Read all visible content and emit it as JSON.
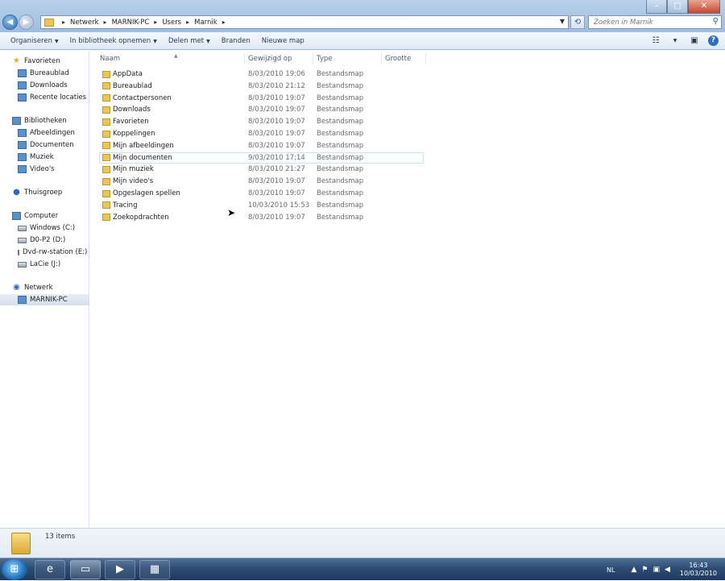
{
  "address": {
    "crumbs": [
      "Netwerk",
      "MARNIK-PC",
      "Users",
      "Marnik"
    ],
    "search_placeholder": "Zoeken in Marnik"
  },
  "toolbar": {
    "organize": "Organiseren",
    "library": "In bibliotheek opnemen",
    "share": "Delen met",
    "burn": "Branden",
    "new_folder": "Nieuwe map"
  },
  "nav": {
    "favorites": {
      "label": "Favorieten",
      "items": [
        "Bureaublad",
        "Downloads",
        "Recente locaties"
      ]
    },
    "libraries": {
      "label": "Bibliotheken",
      "items": [
        "Afbeeldingen",
        "Documenten",
        "Muziek",
        "Video's"
      ]
    },
    "homegroup": "Thuisgroep",
    "computer": {
      "label": "Computer",
      "items": [
        "Windows (C:)",
        "D0-P2 (D:)",
        "Dvd-rw-station (E:) (",
        "LaCie (J:)"
      ]
    },
    "network": {
      "label": "Netwerk",
      "items": [
        "MARNIK-PC"
      ]
    }
  },
  "columns": {
    "name": "Naam",
    "modified": "Gewijzigd op",
    "type": "Type",
    "size": "Grootte"
  },
  "files": [
    {
      "name": "AppData",
      "date": "8/03/2010 19:06",
      "type": "Bestandsmap"
    },
    {
      "name": "Bureaublad",
      "date": "8/03/2010 21:12",
      "type": "Bestandsmap"
    },
    {
      "name": "Contactpersonen",
      "date": "8/03/2010 19:07",
      "type": "Bestandsmap"
    },
    {
      "name": "Downloads",
      "date": "8/03/2010 19:07",
      "type": "Bestandsmap"
    },
    {
      "name": "Favorieten",
      "date": "8/03/2010 19:07",
      "type": "Bestandsmap"
    },
    {
      "name": "Koppelingen",
      "date": "8/03/2010 19:07",
      "type": "Bestandsmap"
    },
    {
      "name": "Mijn afbeeldingen",
      "date": "8/03/2010 19:07",
      "type": "Bestandsmap"
    },
    {
      "name": "Mijn documenten",
      "date": "9/03/2010 17:14",
      "type": "Bestandsmap"
    },
    {
      "name": "Mijn muziek",
      "date": "8/03/2010 21:27",
      "type": "Bestandsmap"
    },
    {
      "name": "Mijn video's",
      "date": "8/03/2010 19:07",
      "type": "Bestandsmap"
    },
    {
      "name": "Opgeslagen spellen",
      "date": "8/03/2010 19:07",
      "type": "Bestandsmap"
    },
    {
      "name": "Tracing",
      "date": "10/03/2010 15:53",
      "type": "Bestandsmap"
    },
    {
      "name": "Zoekopdrachten",
      "date": "8/03/2010 19:07",
      "type": "Bestandsmap"
    }
  ],
  "status": {
    "count": "13 items"
  },
  "taskbar": {
    "lang": "NL",
    "time": "16:43",
    "date": "10/03/2010"
  }
}
